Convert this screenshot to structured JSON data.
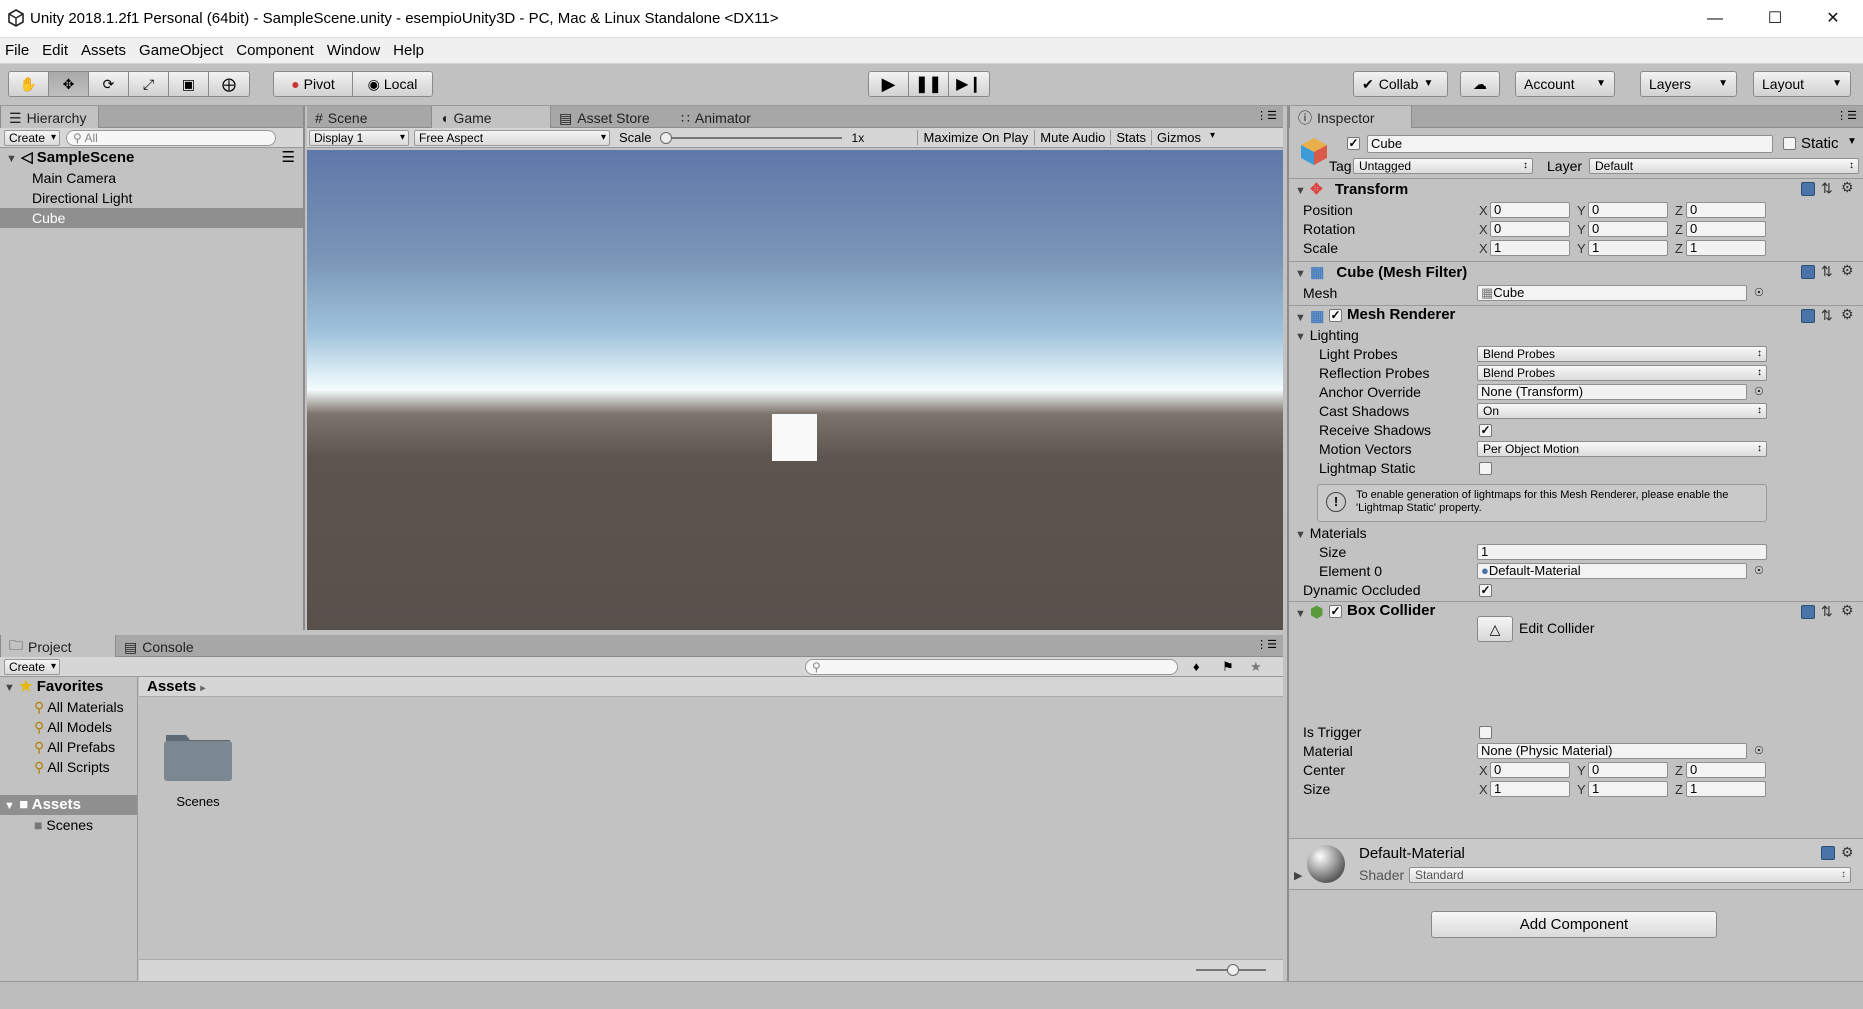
{
  "window": {
    "title": "Unity 2018.1.2f1 Personal (64bit) - SampleScene.unity - esempioUnity3D - PC, Mac & Linux Standalone <DX11>"
  },
  "menu": [
    "File",
    "Edit",
    "Assets",
    "GameObject",
    "Component",
    "Window",
    "Help"
  ],
  "toolbar": {
    "pivot": "Pivot",
    "local": "Local",
    "collab": "Collab",
    "account": "Account",
    "layers": "Layers",
    "layout": "Layout"
  },
  "hierarchy": {
    "tab": "Hierarchy",
    "create": "Create",
    "search_placeholder": "All",
    "scene": "SampleScene",
    "items": [
      "Main Camera",
      "Directional Light",
      "Cube"
    ],
    "selected": "Cube"
  },
  "tabs": {
    "scene": "Scene",
    "game": "Game",
    "asset_store": "Asset Store",
    "animator": "Animator"
  },
  "game": {
    "display": "Display 1",
    "aspect": "Free Aspect",
    "scale_label": "Scale",
    "scale_value": "1x",
    "maximize": "Maximize On Play",
    "mute": "Mute Audio",
    "stats": "Stats",
    "gizmos": "Gizmos"
  },
  "project": {
    "tab": "Project",
    "console_tab": "Console",
    "create": "Create",
    "favorites": "Favorites",
    "fav_items": [
      "All Materials",
      "All Models",
      "All Prefabs",
      "All Scripts"
    ],
    "assets": "Assets",
    "asset_children": [
      "Scenes"
    ],
    "breadcrumb": "Assets",
    "folder": "Scenes"
  },
  "inspector": {
    "tab": "Inspector",
    "object_name": "Cube",
    "static": "Static",
    "tag_label": "Tag",
    "tag": "Untagged",
    "layer_label": "Layer",
    "layer": "Default",
    "transform": {
      "title": "Transform",
      "position": {
        "label": "Position",
        "x": "0",
        "y": "0",
        "z": "0"
      },
      "rotation": {
        "label": "Rotation",
        "x": "0",
        "y": "0",
        "z": "0"
      },
      "scale": {
        "label": "Scale",
        "x": "1",
        "y": "1",
        "z": "1"
      }
    },
    "mesh_filter": {
      "title": "Cube (Mesh Filter)",
      "mesh_label": "Mesh",
      "mesh": "Cube"
    },
    "mesh_renderer": {
      "title": "Mesh Renderer",
      "lighting": "Lighting",
      "light_probes_label": "Light Probes",
      "light_probes": "Blend Probes",
      "reflection_probes_label": "Reflection Probes",
      "reflection_probes": "Blend Probes",
      "anchor_override_label": "Anchor Override",
      "anchor_override": "None (Transform)",
      "cast_shadows_label": "Cast Shadows",
      "cast_shadows": "On",
      "receive_shadows_label": "Receive Shadows",
      "receive_shadows": true,
      "motion_vectors_label": "Motion Vectors",
      "motion_vectors": "Per Object Motion",
      "lightmap_static_label": "Lightmap Static",
      "lightmap_static": false,
      "info": "To enable generation of lightmaps for this Mesh Renderer, please enable the 'Lightmap Static' property.",
      "materials": "Materials",
      "size_label": "Size",
      "size": "1",
      "element0_label": "Element 0",
      "element0": "Default-Material",
      "dynamic_occluded_label": "Dynamic Occluded",
      "dynamic_occluded": true
    },
    "box_collider": {
      "title": "Box Collider",
      "edit_collider": "Edit Collider",
      "is_trigger_label": "Is Trigger",
      "is_trigger": false,
      "material_label": "Material",
      "material": "None (Physic Material)",
      "center": {
        "label": "Center",
        "x": "0",
        "y": "0",
        "z": "0"
      },
      "size": {
        "label": "Size",
        "x": "1",
        "y": "1",
        "z": "1"
      }
    },
    "material": {
      "name": "Default-Material",
      "shader_label": "Shader",
      "shader": "Standard"
    },
    "add_component": "Add Component",
    "axis": {
      "x": "X",
      "y": "Y",
      "z": "Z"
    }
  },
  "colors": {
    "accent_blue": "#4a74a8",
    "selected_row": "#8f8f8f",
    "sky_top": "#5f7bab",
    "ground": "#5a524c"
  }
}
